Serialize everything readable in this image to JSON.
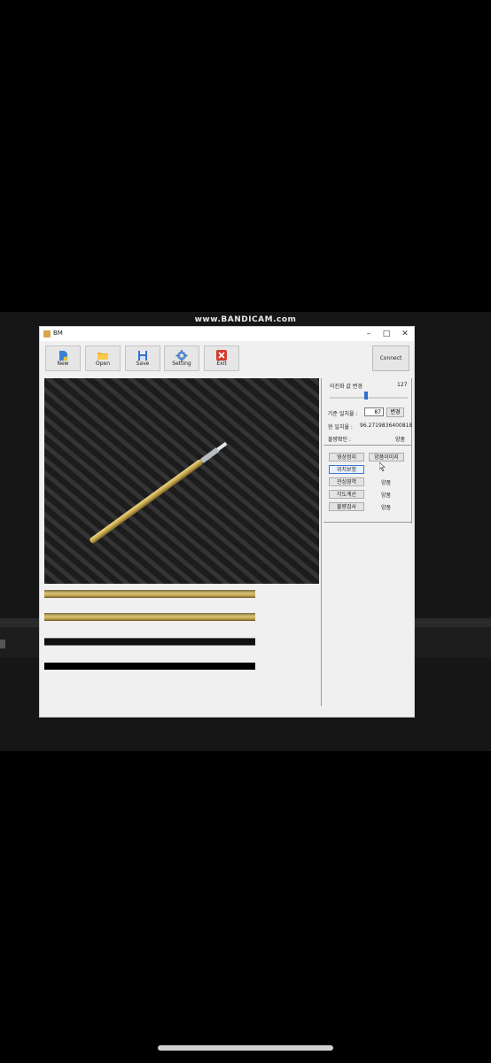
{
  "watermark": "www.BANDICAM.com",
  "window": {
    "title": "BM",
    "controls": {
      "minimize": "–",
      "maximize": "□",
      "close": "✕"
    }
  },
  "toolbar": {
    "new_label": "New",
    "open_label": "Open",
    "save_label": "Save",
    "setting_label": "Setting",
    "exit_label": "Exit",
    "connect_label": "Connect"
  },
  "panel": {
    "threshold_label": "이진화 값 변경",
    "threshold_value": "127",
    "slider_level": 0.47,
    "ref_match_label": "기준 일치율 :",
    "ref_match_value": "87",
    "change_label": "변경",
    "cur_match_label": "현 일치율 :",
    "cur_match_value": "96.2719836400818",
    "defect_label": "불량확인 :",
    "defect_value": "양품",
    "buttons": {
      "video_stop": "영상정지",
      "save_good": "양품이미지",
      "position_correct": "위치보정",
      "roi": "관심영역",
      "angle": "각도계산",
      "foreign": "불량검사"
    },
    "results": {
      "roi": "양품",
      "angle": "양품",
      "foreign": "양품"
    }
  },
  "icons": {
    "new": "new-file-icon",
    "open": "folder-icon",
    "save": "save-icon",
    "setting": "gear-icon",
    "exit": "exit-x-icon"
  },
  "colors": {
    "accent": "#2f6fd0",
    "exit_red": "#d23a2e",
    "probe_gold": "#c9a94e"
  }
}
